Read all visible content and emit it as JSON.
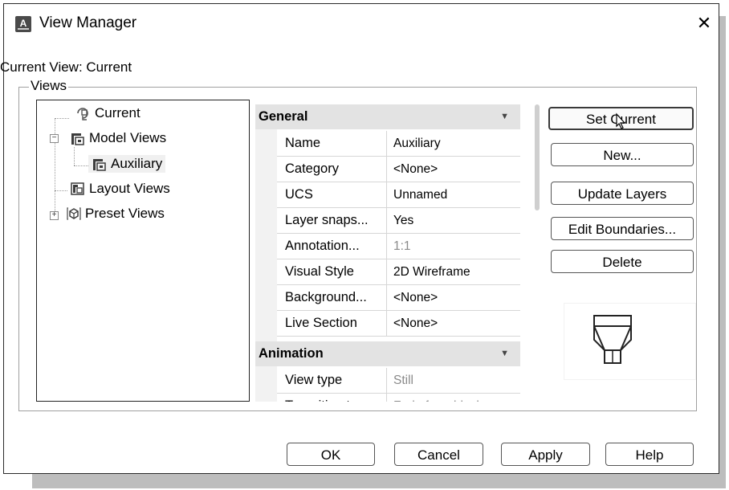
{
  "window": {
    "title": "View Manager",
    "close_glyph": "✕",
    "app_icon_letter": "A"
  },
  "current_view": "Current View: Current",
  "views_group_label": "Views",
  "tree": {
    "items": [
      {
        "label": "Current",
        "icon": "current-view-icon"
      },
      {
        "label": "Model Views",
        "icon": "model-views-icon",
        "expanded": true,
        "expander": "−"
      },
      {
        "label": "Auxiliary",
        "icon": "named-view-icon",
        "selected": true
      },
      {
        "label": "Layout Views",
        "icon": "layout-views-icon"
      },
      {
        "label": "Preset Views",
        "icon": "preset-views-icon",
        "expanded": false,
        "expander": "+"
      }
    ]
  },
  "properties": {
    "general": {
      "header": "General",
      "rows": [
        {
          "key": "Name",
          "value": "Auxiliary"
        },
        {
          "key": "Category",
          "value": "<None>"
        },
        {
          "key": "UCS",
          "value": "Unnamed"
        },
        {
          "key": "Layer snaps...",
          "value": "Yes"
        },
        {
          "key": "Annotation...",
          "value": "1:1",
          "disabled": true
        },
        {
          "key": "Visual Style",
          "value": "2D Wireframe"
        },
        {
          "key": "Background...",
          "value": "<None>"
        },
        {
          "key": "Live Section",
          "value": "<None>"
        }
      ]
    },
    "animation": {
      "header": "Animation",
      "rows": [
        {
          "key": "View type",
          "value": "Still",
          "disabled": true
        },
        {
          "key": "Transition t...",
          "value": "Fade from black",
          "disabled": true
        }
      ]
    }
  },
  "side_buttons": {
    "set_current": "Set Current",
    "new": "New...",
    "update_layers": "Update Layers",
    "edit_boundaries": "Edit Boundaries...",
    "delete": "Delete"
  },
  "footer_buttons": {
    "ok": "OK",
    "cancel": "Cancel",
    "apply": "Apply",
    "help": "Help"
  },
  "colors": {
    "category_header": "#e3e3e3",
    "border": "#2b2b2b",
    "shadow": "#bdbdbd"
  }
}
